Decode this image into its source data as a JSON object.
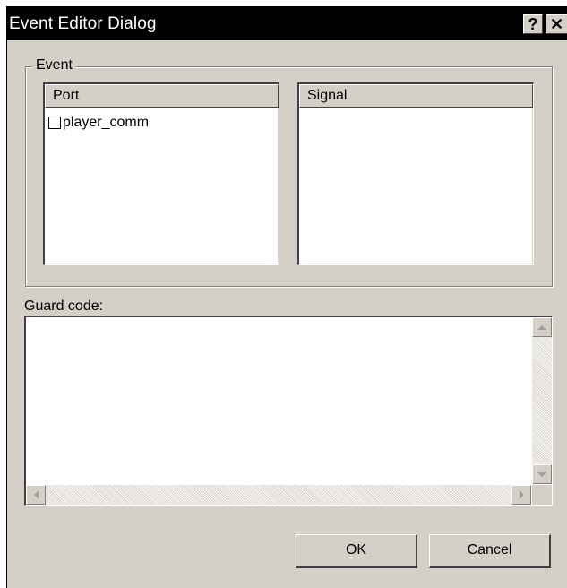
{
  "window": {
    "title": "Event Editor Dialog",
    "help_glyph": "?",
    "close_glyph": "✕"
  },
  "event_group": {
    "label": "Event",
    "port_list": {
      "header": "Port",
      "items": [
        {
          "label": "player_comm",
          "checked": false
        }
      ]
    },
    "signal_list": {
      "header": "Signal",
      "items": []
    }
  },
  "guard": {
    "label": "Guard code:",
    "value": ""
  },
  "buttons": {
    "ok": "OK",
    "cancel": "Cancel"
  },
  "icons": [
    "help-icon",
    "close-icon",
    "scroll-up-icon",
    "scroll-down-icon",
    "scroll-left-icon",
    "scroll-right-icon",
    "checkbox-icon"
  ]
}
